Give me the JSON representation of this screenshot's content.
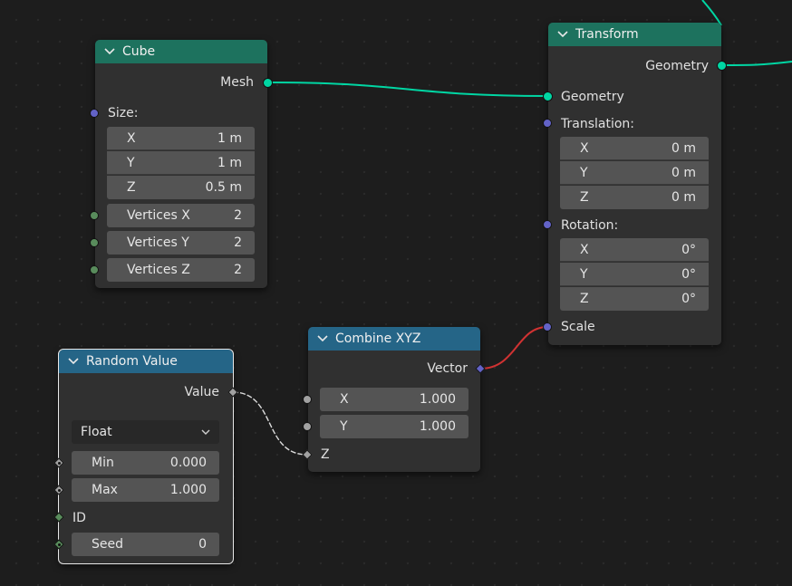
{
  "nodes": {
    "cube": {
      "title": "Cube",
      "output_mesh": "Mesh",
      "size_label": "Size:",
      "size": [
        {
          "label": "X",
          "value": "1 m"
        },
        {
          "label": "Y",
          "value": "1 m"
        },
        {
          "label": "Z",
          "value": "0.5 m"
        }
      ],
      "vertices": [
        {
          "label": "Vertices X",
          "value": "2"
        },
        {
          "label": "Vertices Y",
          "value": "2"
        },
        {
          "label": "Vertices Z",
          "value": "2"
        }
      ]
    },
    "transform": {
      "title": "Transform",
      "output_geometry": "Geometry",
      "input_geometry": "Geometry",
      "translation_label": "Translation:",
      "translation": [
        {
          "label": "X",
          "value": "0 m"
        },
        {
          "label": "Y",
          "value": "0 m"
        },
        {
          "label": "Z",
          "value": "0 m"
        }
      ],
      "rotation_label": "Rotation:",
      "rotation": [
        {
          "label": "X",
          "value": "0°"
        },
        {
          "label": "Y",
          "value": "0°"
        },
        {
          "label": "Z",
          "value": "0°"
        }
      ],
      "scale_label": "Scale"
    },
    "combine_xyz": {
      "title": "Combine XYZ",
      "output_vector": "Vector",
      "x": {
        "label": "X",
        "value": "1.000"
      },
      "y": {
        "label": "Y",
        "value": "1.000"
      },
      "z_label": "Z"
    },
    "random_value": {
      "title": "Random Value",
      "output_value": "Value",
      "data_type": "Float",
      "min": {
        "label": "Min",
        "value": "0.000"
      },
      "max": {
        "label": "Max",
        "value": "1.000"
      },
      "id_label": "ID",
      "seed": {
        "label": "Seed",
        "value": "0"
      }
    }
  },
  "colors": {
    "geometry_header": "#1d725e",
    "converter_header": "#256587",
    "geometry_link": "#00d6a3",
    "vector_to_vector_link": "#d03232",
    "float_link": "#dcdcdc"
  }
}
